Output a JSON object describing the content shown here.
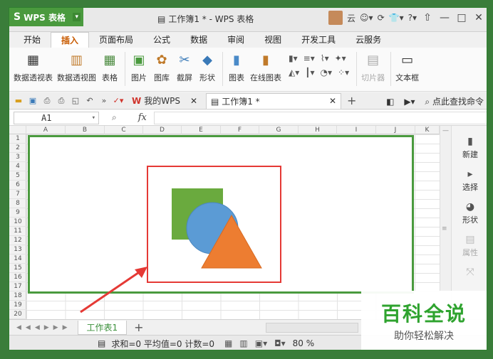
{
  "titlebar": {
    "app_name": "WPS 表格",
    "doc_title": "工作簿1 * - WPS 表格",
    "user_label": "云"
  },
  "menu": {
    "tabs": [
      "开始",
      "插入",
      "页面布局",
      "公式",
      "数据",
      "审阅",
      "视图",
      "开发工具",
      "云服务"
    ],
    "active_index": 1
  },
  "ribbon": {
    "pivot_table": "数据透视表",
    "pivot_chart": "数据透视图",
    "table": "表格",
    "picture": "图片",
    "gallery": "图库",
    "screenshot": "截屏",
    "shape": "形状",
    "chart": "图表",
    "online_chart": "在线图表",
    "slicer": "切片器",
    "textbox": "文本框"
  },
  "docbar": {
    "my_wps": "我的WPS",
    "active_doc": "工作簿1 *",
    "search_cmd": "点此查找命令"
  },
  "formula": {
    "cell_ref": "A1",
    "fx": "fx"
  },
  "grid": {
    "columns": [
      "A",
      "B",
      "C",
      "D",
      "E",
      "F",
      "G",
      "H",
      "I",
      "J",
      "K"
    ],
    "rows": [
      "1",
      "2",
      "3",
      "4",
      "5",
      "6",
      "7",
      "8",
      "9",
      "10",
      "11",
      "12",
      "13",
      "14",
      "15",
      "16",
      "17",
      "18",
      "19",
      "20"
    ]
  },
  "side_panel": {
    "new": "新建",
    "select": "选择",
    "shape": "形状",
    "property": "属性"
  },
  "sheets": {
    "active": "工作表1",
    "add": "+"
  },
  "status": {
    "summary": "求和=0  平均值=0  计数=0",
    "zoom": "80 %"
  },
  "watermark": {
    "title": "百科全说",
    "subtitle": "助你轻松解决"
  },
  "colors": {
    "accent": "#4a9a3e",
    "highlight_frame": "#e53935",
    "shape_square": "#6aaa3e",
    "shape_circle": "#5b9bd5",
    "shape_triangle": "#ed7d31"
  }
}
